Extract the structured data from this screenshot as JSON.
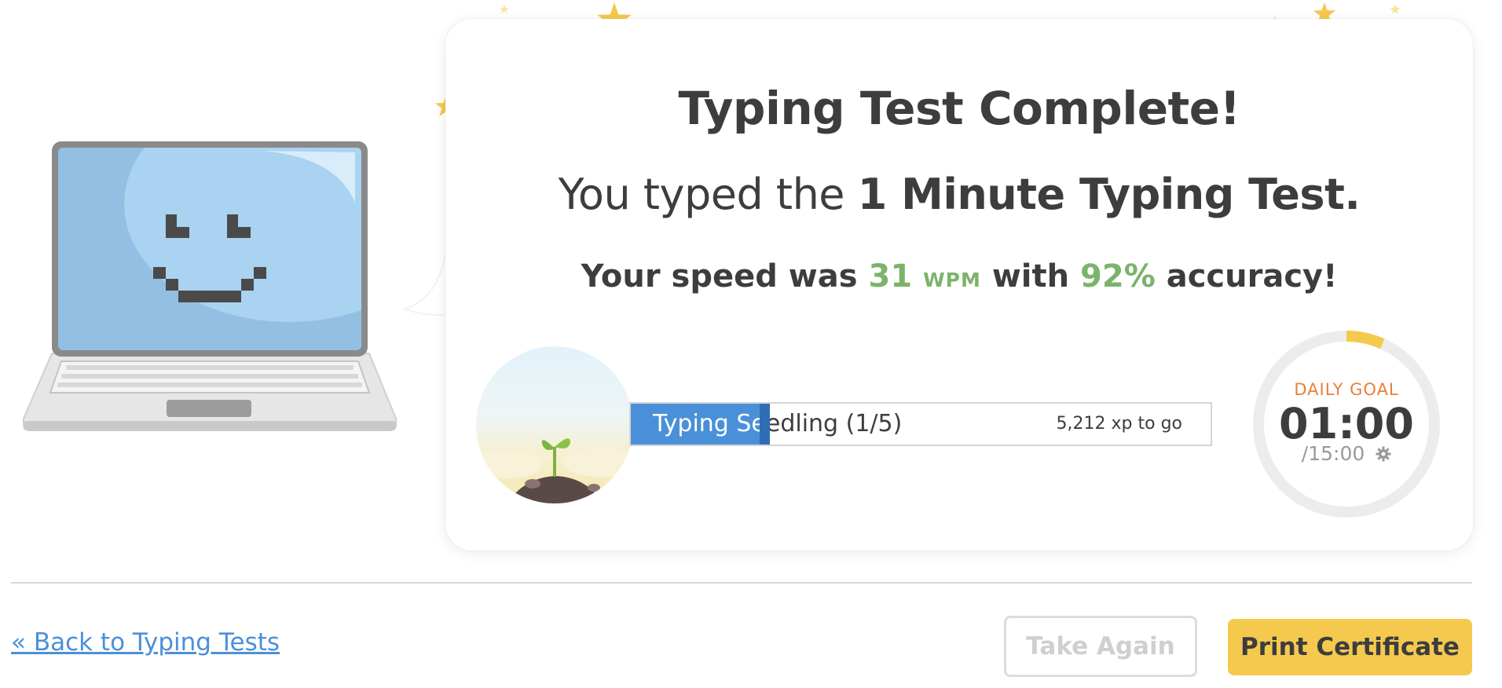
{
  "result": {
    "heading": "Typing Test Complete!",
    "subline_prefix": "You typed the",
    "test_name": "1 Minute Typing Test.",
    "speed_prefix": "Your speed was",
    "wpm_value": "31",
    "wpm_unit": "WPM",
    "speed_middle": "with",
    "accuracy_value": "92%",
    "speed_suffix": "accuracy!"
  },
  "level": {
    "label": "Typing Seedling (1/5)",
    "xp_to_go": "5,212 xp to go",
    "progress_fraction": 0.24
  },
  "daily_goal": {
    "label": "DAILY GOAL",
    "time": "01:00",
    "total": "/15:00",
    "progress_fraction": 0.067
  },
  "footer": {
    "back_link": "« Back to Typing Tests",
    "take_again": "Take Again",
    "print_certificate": "Print Certificate"
  },
  "icons": {
    "mascot": "laptop-smiley-icon",
    "badge": "seedling-icon",
    "settings": "gear-icon",
    "decoration": "star-icon"
  },
  "colors": {
    "accent_blue": "#4a90d9",
    "accent_green": "#7bb36a",
    "goal_orange": "#e8803a",
    "goal_yellow": "#f5c94e",
    "button_yellow": "#f5c94e"
  }
}
